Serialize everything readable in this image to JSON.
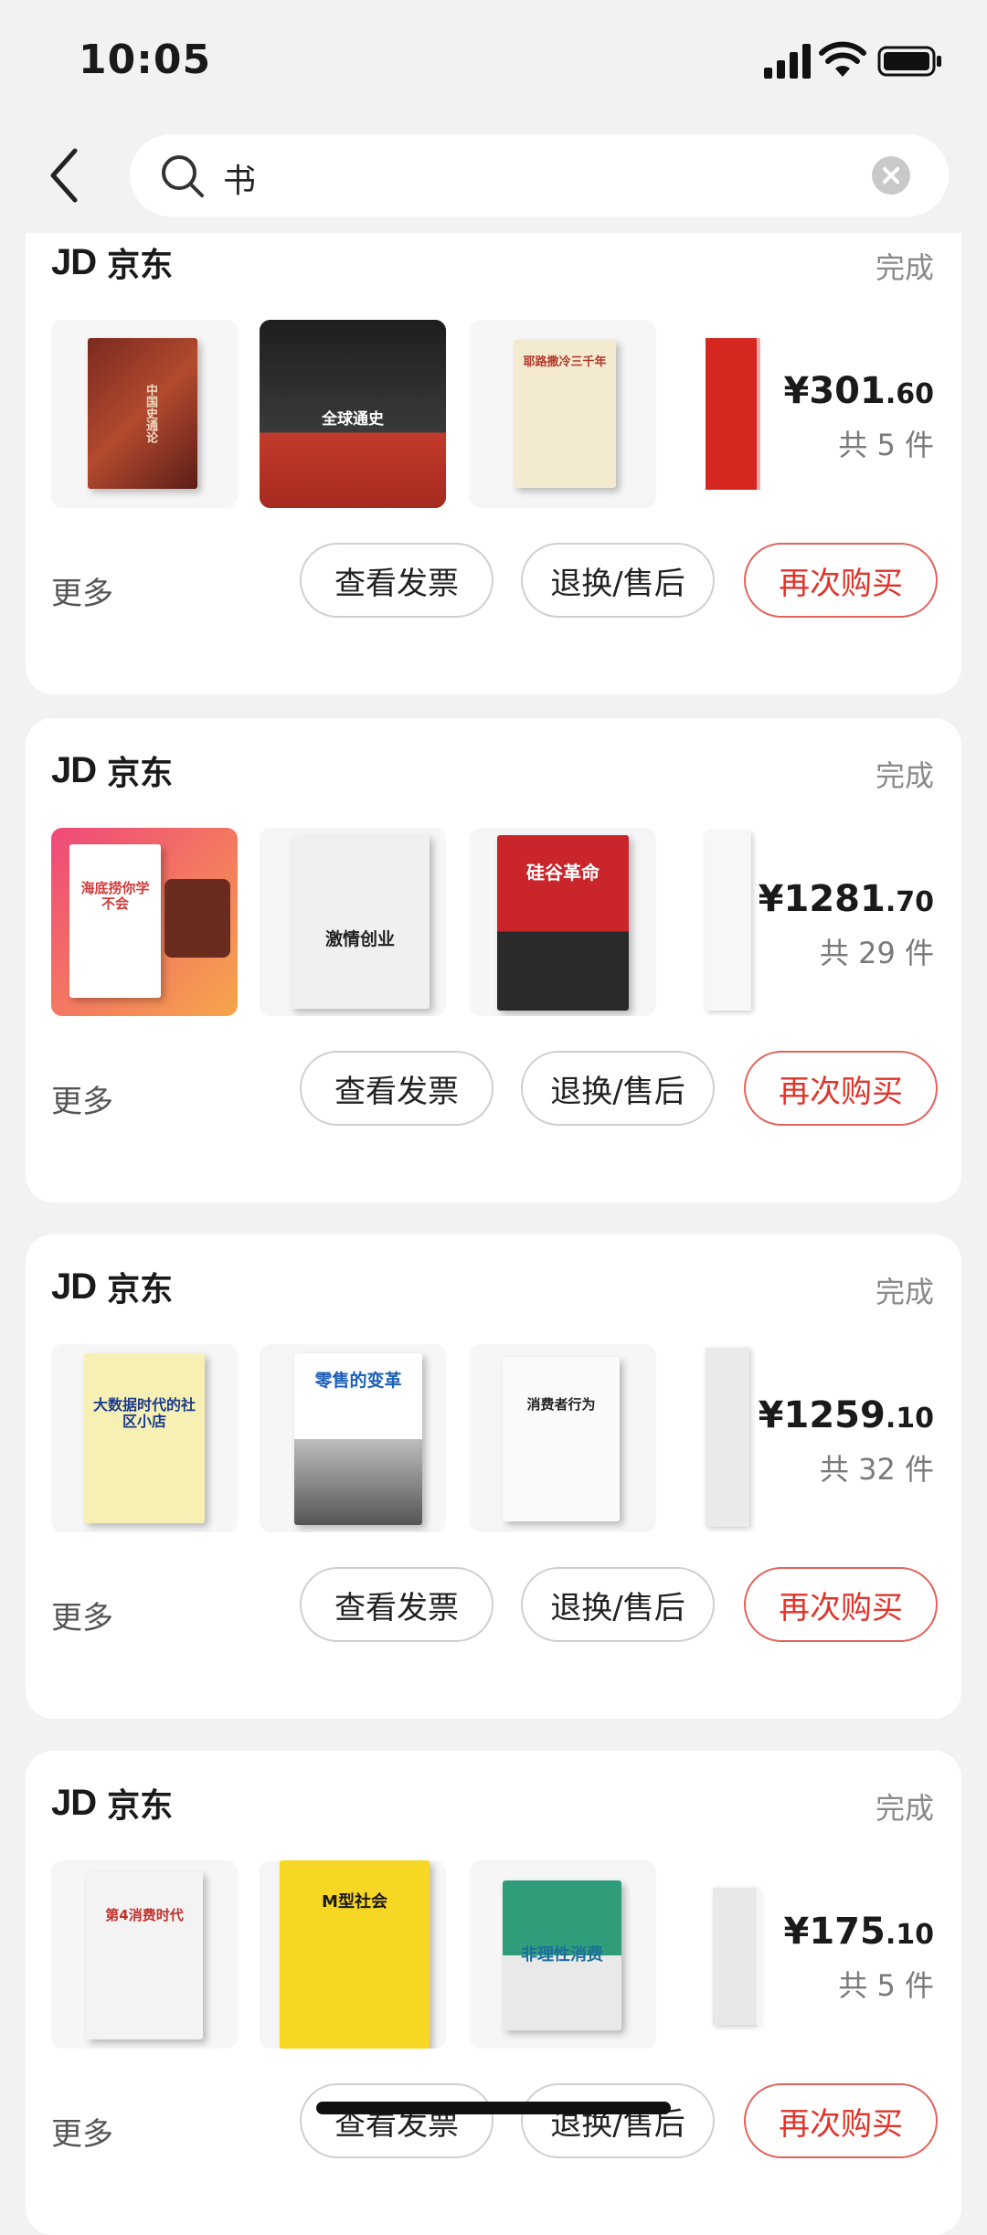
{
  "status_bar": {
    "time": "10:05"
  },
  "search": {
    "query": "书"
  },
  "orders": [
    {
      "store": "京东",
      "logo": "JD",
      "status": "完成",
      "price_main": "¥301",
      "price_cents": ".60",
      "count": "共 5 件",
      "actions": {
        "more": "更多",
        "invoice": "查看发票",
        "returns": "退换/售后",
        "rebuy": "再次购买"
      },
      "books": [
        "中国史通论",
        "全球通史",
        "耶路撒冷三千年"
      ]
    },
    {
      "store": "京东",
      "logo": "JD",
      "status": "完成",
      "price_main": "¥1281",
      "price_cents": ".70",
      "count": "共 29 件",
      "actions": {
        "more": "更多",
        "invoice": "查看发票",
        "returns": "退换/售后",
        "rebuy": "再次购买"
      },
      "books": [
        "海底捞你学不会",
        "激情创业",
        "硅谷革命"
      ]
    },
    {
      "store": "京东",
      "logo": "JD",
      "status": "完成",
      "price_main": "¥1259",
      "price_cents": ".10",
      "count": "共 32 件",
      "actions": {
        "more": "更多",
        "invoice": "查看发票",
        "returns": "退换/售后",
        "rebuy": "再次购买"
      },
      "books": [
        "大数据时代的社区小店",
        "零售的变革",
        "消费者行为"
      ]
    },
    {
      "store": "京东",
      "logo": "JD",
      "status": "完成",
      "price_main": "¥175",
      "price_cents": ".10",
      "count": "共 5 件",
      "actions": {
        "more": "更多",
        "invoice": "查看发票",
        "returns": "退换/售后",
        "rebuy": "再次购买"
      },
      "books": [
        "第4消费时代",
        "M型社会",
        "非理性消费"
      ]
    }
  ]
}
